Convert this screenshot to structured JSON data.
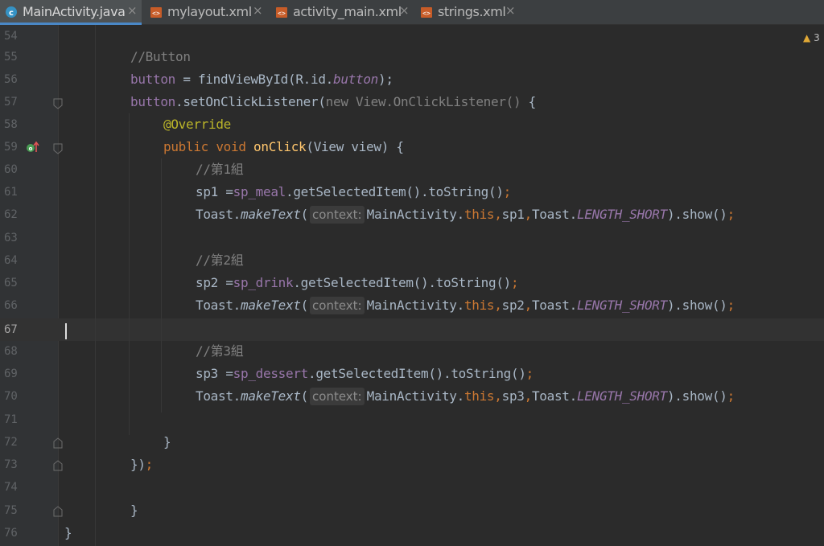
{
  "tabs": [
    {
      "label": "MainActivity.java",
      "icon": "java-class-icon",
      "active": true
    },
    {
      "label": "mylayout.xml",
      "icon": "layout-xml-icon",
      "active": false
    },
    {
      "label": "activity_main.xml",
      "icon": "layout-xml-icon",
      "active": false
    },
    {
      "label": "strings.xml",
      "icon": "layout-xml-icon",
      "active": false
    }
  ],
  "tab_close_glyph": "×",
  "warning_count": "3",
  "current_line": "67",
  "line_numbers": [
    "54",
    "55",
    "56",
    "57",
    "58",
    "59",
    "60",
    "61",
    "62",
    "63",
    "64",
    "65",
    "66",
    "67",
    "68",
    "69",
    "70",
    "71",
    "72",
    "73",
    "74",
    "75",
    "76"
  ],
  "code": {
    "l55": {
      "comment": "//Button"
    },
    "l56": {
      "field": "button",
      "op": " = findViewById(R.id.",
      "field2": "button",
      "tail": ");"
    },
    "l57": {
      "field": "button",
      "call": ".setOnClickListener(",
      "gray": "new View.OnClickListener()",
      "tail": " {"
    },
    "l58": {
      "annotation": "@Override"
    },
    "l59": {
      "kw1": "public",
      "kw2": "void",
      "method": "onClick",
      "tail": "(View view) {"
    },
    "l60": {
      "comment": "//第1組"
    },
    "l61": {
      "var": "sp1",
      "op": " =",
      "field": "sp_meal",
      "tail": ".getSelectedItem().toString()",
      "semi": ";"
    },
    "l62": {
      "cls": "Toast.",
      "method": "makeText",
      "paren": "(",
      "hint": "context:",
      "arg": "MainActivity.",
      "kw": "this",
      "c1": ",",
      "var": "sp1",
      "c2": ",",
      "cls2": "Toast.",
      "const": "LENGTH_SHORT",
      "tail": ").show()",
      "semi": ";"
    },
    "l64": {
      "comment": "//第2組"
    },
    "l65": {
      "var": "sp2",
      "op": " =",
      "field": "sp_drink",
      "tail": ".getSelectedItem().toString()",
      "semi": ";"
    },
    "l66": {
      "cls": "Toast.",
      "method": "makeText",
      "paren": "(",
      "hint": "context:",
      "arg": "MainActivity.",
      "kw": "this",
      "c1": ",",
      "var": "sp2",
      "c2": ",",
      "cls2": "Toast.",
      "const": "LENGTH_SHORT",
      "tail": ").show()",
      "semi": ";"
    },
    "l68": {
      "comment": "//第3組"
    },
    "l69": {
      "var": "sp3",
      "op": " =",
      "field": "sp_dessert",
      "tail": ".getSelectedItem().toString()",
      "semi": ";"
    },
    "l70": {
      "cls": "Toast.",
      "method": "makeText",
      "paren": "(",
      "hint": "context:",
      "arg": "MainActivity.",
      "kw": "this",
      "c1": ",",
      "var": "sp3",
      "c2": ",",
      "cls2": "Toast.",
      "const": "LENGTH_SHORT",
      "tail": ").show()",
      "semi": ";"
    },
    "l72": {
      "text": "}"
    },
    "l73": {
      "text": "})",
      "semi": ";"
    },
    "l75": {
      "text": "}"
    },
    "l76": {
      "text": "}"
    }
  },
  "colors": {
    "background": "#2b2b2b",
    "keyword": "#cc7832",
    "field": "#9876aa",
    "method": "#ffc66d",
    "annotation": "#bbb529",
    "comment": "#808080"
  }
}
